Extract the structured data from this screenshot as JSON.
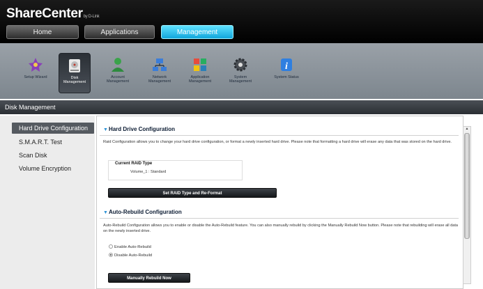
{
  "app": {
    "logo": "ShareCenter",
    "logo_by": "by D-Link"
  },
  "tabs": [
    {
      "label": "Home",
      "active": false
    },
    {
      "label": "Applications",
      "active": false
    },
    {
      "label": "Management",
      "active": true
    }
  ],
  "toolbar": [
    {
      "label": "Setup Wizard",
      "icon": "wizard-icon",
      "selected": false
    },
    {
      "label": "Disk Management",
      "icon": "disk-icon",
      "selected": true
    },
    {
      "label": "Account Management",
      "icon": "account-icon",
      "selected": false
    },
    {
      "label": "Network Management",
      "icon": "network-icon",
      "selected": false
    },
    {
      "label": "Application Management",
      "icon": "apps-icon",
      "selected": false
    },
    {
      "label": "System Management",
      "icon": "gear-icon",
      "selected": false
    },
    {
      "label": "System Status",
      "icon": "info-icon",
      "selected": false
    }
  ],
  "section": {
    "title": "Disk Management"
  },
  "sidebar": {
    "items": [
      {
        "label": "Hard Drive Configuration",
        "active": true
      },
      {
        "label": "S.M.A.R.T. Test",
        "active": false
      },
      {
        "label": "Scan Disk",
        "active": false
      },
      {
        "label": "Volume Encryption",
        "active": false
      }
    ]
  },
  "hdconfig": {
    "title": "Hard Drive Configuration",
    "description": "Raid Configuration allows you to change your hard drive configuration, or format a newly inserted hard drive. Please note that formatting a hard drive will erase any data that was stored on the hard drive.",
    "raid_label": "Current RAID Type",
    "raid_value": "Volume_1 : Standard",
    "button": "Set RAID Type and Re-Format"
  },
  "autorebuild": {
    "title": "Auto-Rebuild Configuration",
    "description": "Auto-Rebuild Configuration allows you to enable or disable the Auto-Rebuild feature. You can also manually rebuild by clicking the Manually Rebuild Now button. Please note that rebuilding will erase all data on the newly inserted drive.",
    "options": [
      {
        "label": "Enable Auto-Rebuild",
        "checked": false
      },
      {
        "label": "Disable Auto-Rebuild",
        "checked": true
      }
    ],
    "button": "Manually Rebuild Now"
  }
}
